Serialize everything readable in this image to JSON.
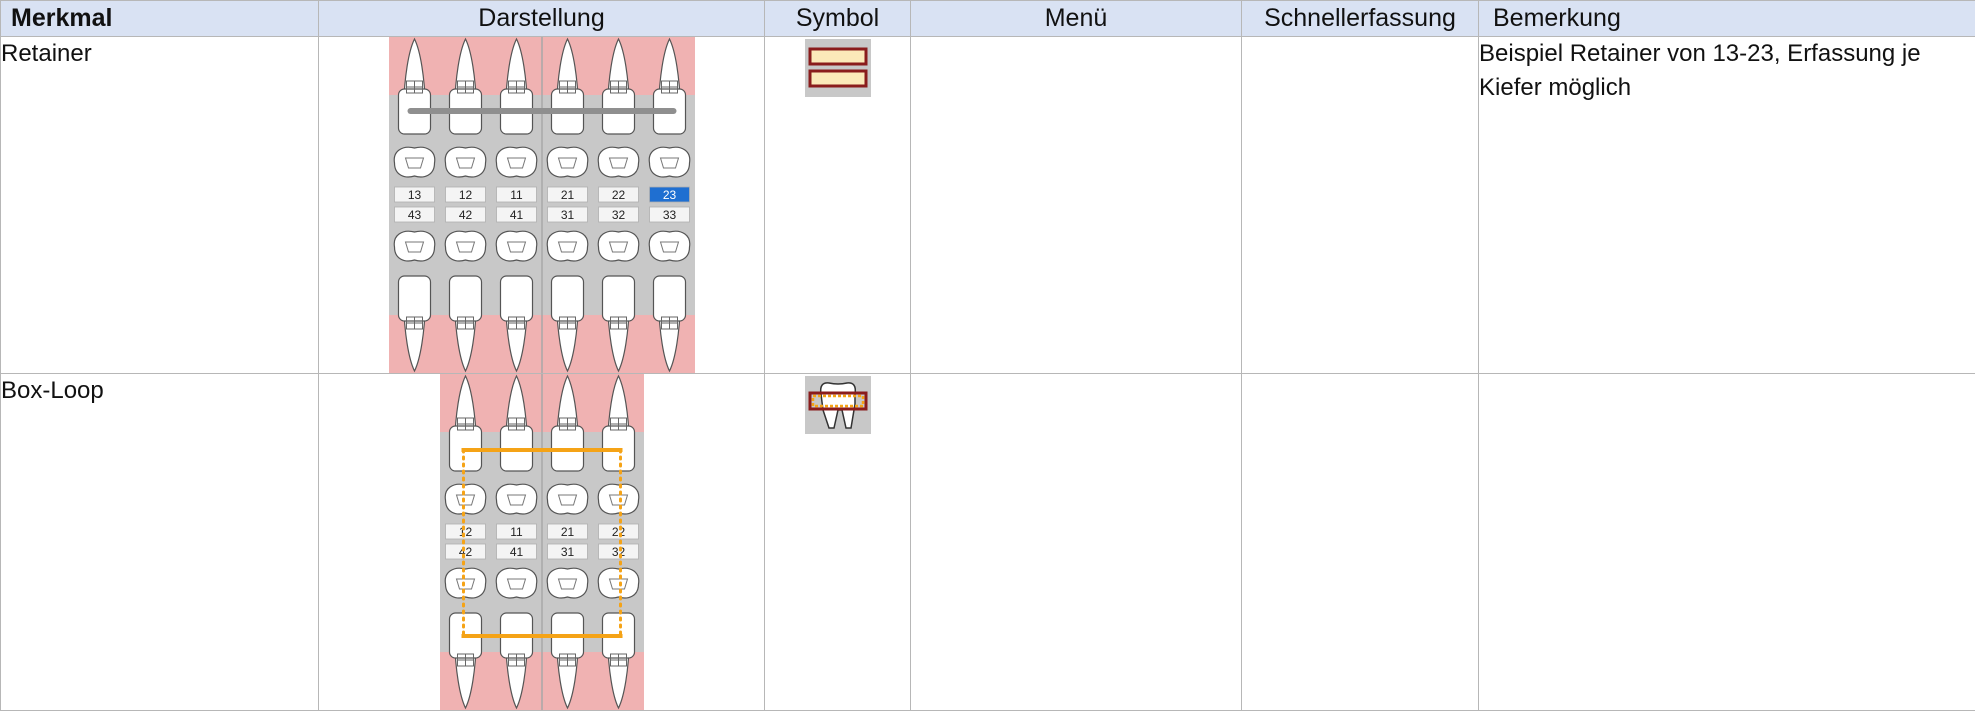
{
  "header": {
    "col_feature": "Merkmal",
    "col_display": "Darstellung",
    "col_symbol": "Symbol",
    "col_menu": "Menü",
    "col_quick": "Schnellerfassung",
    "col_remark": "Bemerkung"
  },
  "rows": [
    {
      "feature": "Retainer",
      "remark": "Beispiel Retainer von 13-23, Erfassung je Kiefer möglich",
      "menu": "",
      "quick": "",
      "symbol_icon": "retainer-symbol-icon",
      "upper_numbers": [
        "13",
        "12",
        "11",
        "21",
        "22",
        "23"
      ],
      "lower_numbers": [
        "43",
        "42",
        "41",
        "31",
        "32",
        "33"
      ],
      "selected_tooth": "23"
    },
    {
      "feature": "Box-Loop",
      "remark": "",
      "menu": "",
      "quick": "",
      "symbol_icon": "box-loop-symbol-icon",
      "upper_numbers": [
        "12",
        "11",
        "21",
        "22"
      ],
      "lower_numbers": [
        "42",
        "41",
        "31",
        "32"
      ]
    }
  ],
  "colors": {
    "header_bg": "#d9e2f3",
    "gum": "#f0b2b2",
    "chart_bg": "#c8c8c8",
    "selected_badge": "#1f6fd1",
    "retainer_bar": "#8f8f8f",
    "box_loop": "#f5a316"
  }
}
